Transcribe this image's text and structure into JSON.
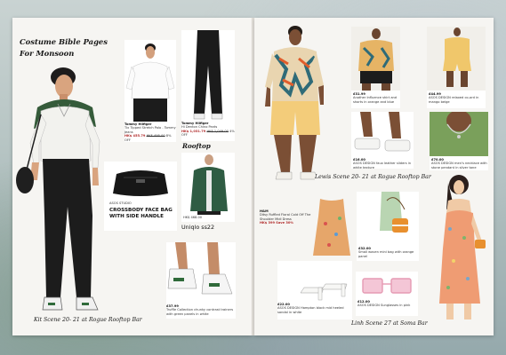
{
  "book": {
    "title_line1": "Costume Bible Pages",
    "title_line2": "For Monsoon"
  },
  "left": {
    "character_caption": "Kit  Scene 20- 21 at Rogue Rooftop Bar",
    "polo": {
      "brand": "Tommy Hilfiger",
      "name": "Tix Tipped Stretch Polo - Tommy Jeans",
      "price": "HK$ 455.79",
      "old_price": "HK$ 495.00",
      "pct": "8% OFF"
    },
    "chinos": {
      "brand": "Tommy Hilfiger",
      "name": "Hi Denton Chino Pants",
      "price": "HK$ 1,031.79",
      "old_price": "HK$ 1,049.00",
      "pct": "4% OFF"
    },
    "rooftop_label": "Rooftop",
    "bag": {
      "brand": "ASOS STUDIO",
      "headline": "CROSSBODY FACE BAG WITH SIDE HANDLE"
    },
    "jacket": {
      "price": "HK$ 468.00",
      "label": "Uniqlo ss22"
    },
    "shoes": {
      "price": "£37.99",
      "name": "Truffle Collection chunky contrast trainers with green panels in white"
    }
  },
  "right": {
    "lewis_caption": "Lewis  Scene 20- 21 at Rogue Rooftop Bar",
    "linh_caption": "Linh  Scene 27 at Soma Bar",
    "shirt": {
      "price": "£31.99",
      "name": "Another Influence shirt and shorts in orange and blue"
    },
    "set": {
      "price": "£44.99",
      "name": "ASOS DESIGN relaxed co-ord in mango beige"
    },
    "slides": {
      "price": "£16.00",
      "name": "ASOS DESIGN faux leather sliders in white texture"
    },
    "necklace": {
      "price": "£70.00",
      "name": "ASOS DESIGN men's necklace with stone pendant in silver tone"
    },
    "dress": {
      "brand": "H&M",
      "name": "Ditsy Ruffled Floral Cold Off The Shoulder Midi Dress",
      "price": "HK$ 399 Save 30%"
    },
    "bag": {
      "price": "£32.00",
      "name": "Small woven mini bag with orange panel"
    },
    "heels": {
      "price": "£22.00",
      "name": "ASOS DESIGN Hampton block mid heeled sandal in white"
    },
    "sunglasses": {
      "price": "£12.00",
      "name": "ASOS DESIGN Sunglasses in pink"
    }
  }
}
